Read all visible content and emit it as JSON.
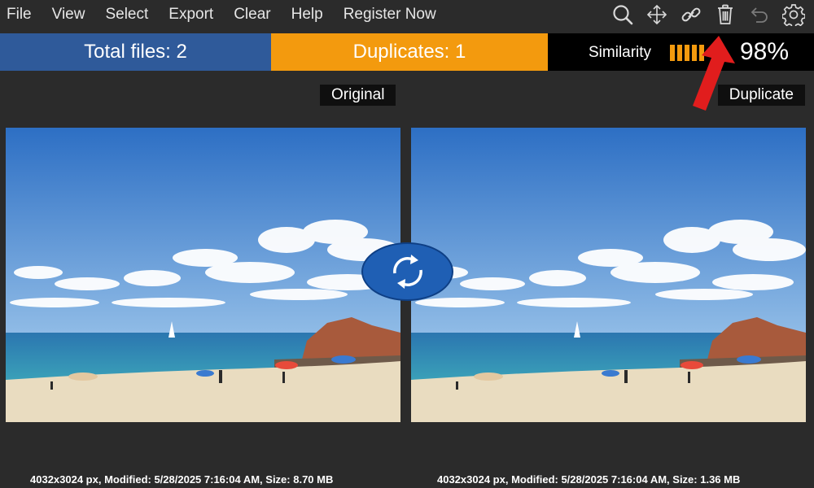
{
  "menu": {
    "items": [
      "File",
      "View",
      "Select",
      "Export",
      "Clear",
      "Help",
      "Register Now"
    ]
  },
  "toolbar": {
    "icons": [
      "search-icon",
      "move-icon",
      "link-icon",
      "trash-icon",
      "undo-icon",
      "settings-icon"
    ]
  },
  "status": {
    "total_files": "Total files: 2",
    "duplicates": "Duplicates: 1",
    "similarity_label": "Similarity",
    "similarity_value": "98%",
    "similarity_level": 0.98,
    "colors": {
      "total": "#2f5a9a",
      "duplicates": "#f39a0e",
      "similarity_bg": "#000000"
    }
  },
  "compare": {
    "original_caption": "Original",
    "duplicate_caption": "Duplicate",
    "original_info": "4032x3024 px, Modified: 5/28/2025 7:16:04 AM, Size: 8.70 MB",
    "duplicate_info": "4032x3024 px, Modified: 5/28/2025 7:16:04 AM, Size: 1.36 MB"
  }
}
